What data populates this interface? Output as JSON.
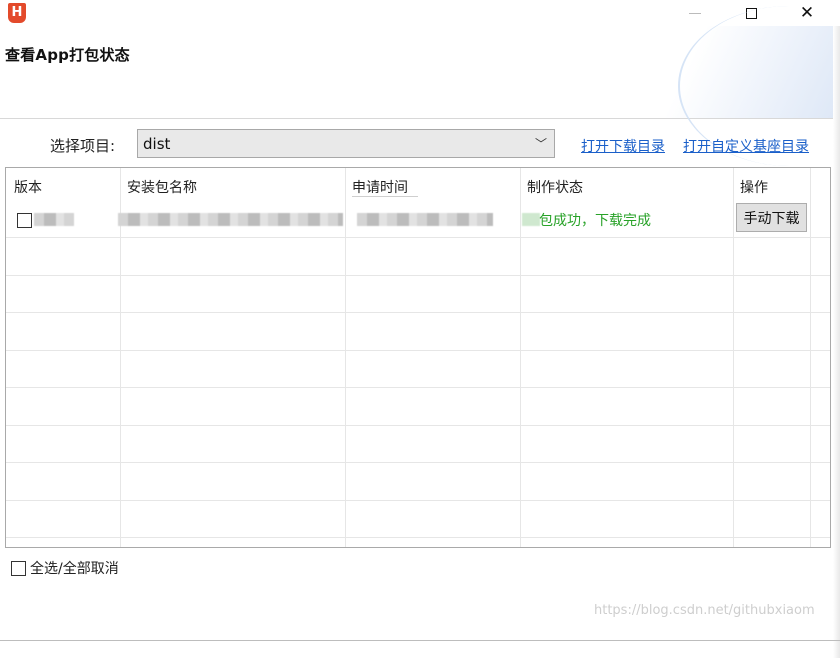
{
  "window": {
    "logo_text": "H",
    "minimize_symbol": "",
    "close_symbol": "✕"
  },
  "header": {
    "title": "查看App打包状态"
  },
  "project": {
    "label": "选择项目:",
    "selected": "dist",
    "chevron": "﹀"
  },
  "links": {
    "open_download_dir": "打开下载目录",
    "open_custom_base_dir": "打开自定义基座目录"
  },
  "table": {
    "columns": [
      "版本",
      "安装包名称",
      "申请时间",
      "制作状态",
      "操作"
    ],
    "rows": [
      {
        "status": "包成功，下载完成",
        "action": "手动下载"
      }
    ]
  },
  "footer": {
    "select_all": "全选/全部取消",
    "watermark": "https://blog.csdn.net/githubxiaom"
  },
  "colors": {
    "link": "#1a5fc9",
    "status_success": "#28a228",
    "logo": "#e34a2b"
  }
}
